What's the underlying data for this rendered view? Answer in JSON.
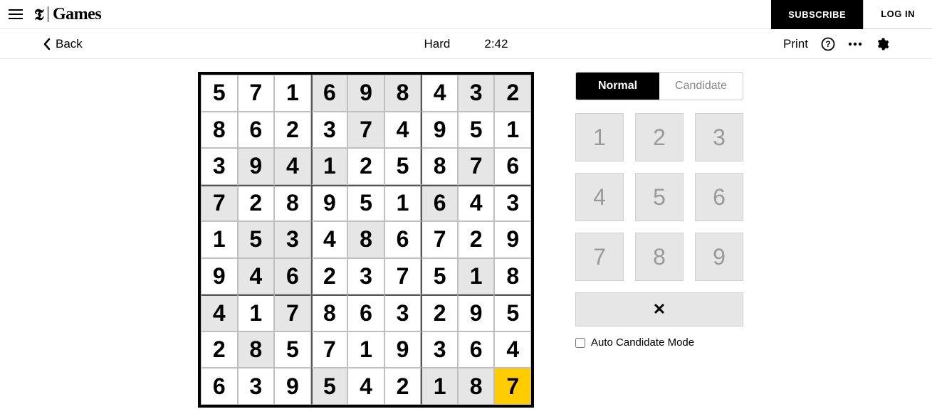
{
  "header": {
    "brand_t": "𝕿",
    "brand_text": "Games",
    "subscribe_label": "SUBSCRIBE",
    "login_label": "LOG IN"
  },
  "toolbar": {
    "back_label": "Back",
    "difficulty": "Hard",
    "timer": "2:42",
    "print_label": "Print"
  },
  "modes": {
    "normal": "Normal",
    "candidate": "Candidate"
  },
  "keypad": [
    "1",
    "2",
    "3",
    "4",
    "5",
    "6",
    "7",
    "8",
    "9"
  ],
  "clear_glyph": "✕",
  "auto_label": "Auto Candidate Mode",
  "board": {
    "values": [
      [
        "5",
        "7",
        "1",
        "6",
        "9",
        "8",
        "4",
        "3",
        "2"
      ],
      [
        "8",
        "6",
        "2",
        "3",
        "7",
        "4",
        "9",
        "5",
        "1"
      ],
      [
        "3",
        "9",
        "4",
        "1",
        "2",
        "5",
        "8",
        "7",
        "6"
      ],
      [
        "7",
        "2",
        "8",
        "9",
        "5",
        "1",
        "6",
        "4",
        "3"
      ],
      [
        "1",
        "5",
        "3",
        "4",
        "8",
        "6",
        "7",
        "2",
        "9"
      ],
      [
        "9",
        "4",
        "6",
        "2",
        "3",
        "7",
        "5",
        "1",
        "8"
      ],
      [
        "4",
        "1",
        "7",
        "8",
        "6",
        "3",
        "2",
        "9",
        "5"
      ],
      [
        "2",
        "8",
        "5",
        "7",
        "1",
        "9",
        "3",
        "6",
        "4"
      ],
      [
        "6",
        "3",
        "9",
        "5",
        "4",
        "2",
        "1",
        "8",
        "7"
      ]
    ],
    "prefilled": [
      [
        0,
        0,
        0,
        1,
        1,
        1,
        0,
        1,
        1
      ],
      [
        0,
        0,
        0,
        0,
        1,
        0,
        0,
        0,
        0
      ],
      [
        0,
        1,
        1,
        1,
        0,
        0,
        0,
        1,
        0
      ],
      [
        1,
        0,
        0,
        0,
        0,
        0,
        1,
        0,
        0
      ],
      [
        0,
        1,
        1,
        0,
        1,
        0,
        0,
        0,
        0
      ],
      [
        0,
        1,
        1,
        0,
        0,
        0,
        0,
        1,
        0
      ],
      [
        1,
        0,
        1,
        0,
        0,
        0,
        0,
        0,
        0
      ],
      [
        0,
        1,
        0,
        0,
        0,
        0,
        0,
        0,
        0
      ],
      [
        0,
        0,
        0,
        1,
        0,
        0,
        1,
        1,
        0
      ]
    ],
    "selected": [
      8,
      8
    ]
  }
}
